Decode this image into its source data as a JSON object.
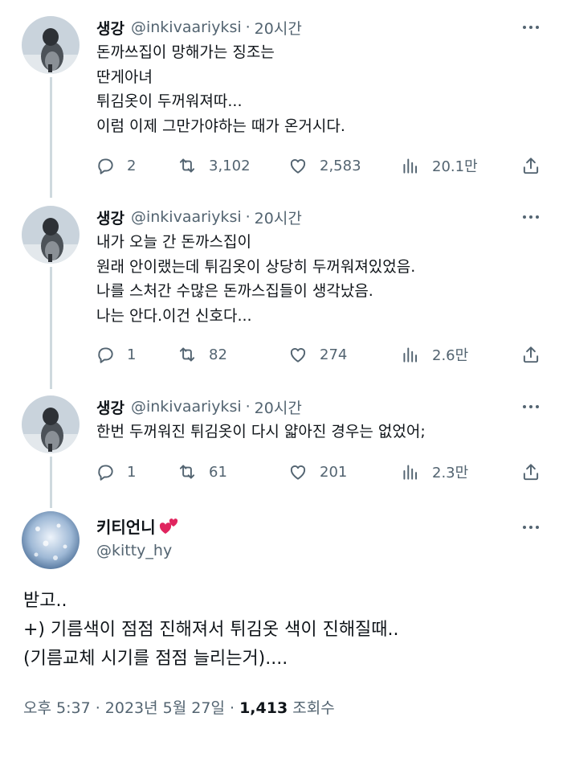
{
  "thread": [
    {
      "name": "생강",
      "handle": "@inkivaariyksi",
      "separator": "·",
      "time": "20시간",
      "lines": [
        "돈까쓰집이 망해가는 징조는",
        "딴게아녀",
        "튀김옷이 두꺼워져따...",
        "이럼 이제 그만가야하는 때가 온거시다."
      ],
      "replies": "2",
      "retweets": "3,102",
      "likes": "2,583",
      "views": "20.1만"
    },
    {
      "name": "생강",
      "handle": "@inkivaariyksi",
      "separator": "·",
      "time": "20시간",
      "lines": [
        "내가 오늘 간 돈까스집이",
        "원래 안이랬는데 튀김옷이 상당히 두꺼워져있었음.",
        "나를 스처간 수많은 돈까스집들이 생각났음.",
        "나는 안다.이건 신호다..."
      ],
      "replies": "1",
      "retweets": "82",
      "likes": "274",
      "views": "2.6만"
    },
    {
      "name": "생강",
      "handle": "@inkivaariyksi",
      "separator": "·",
      "time": "20시간",
      "lines": [
        "한번 두꺼워진 튀김옷이 다시 얇아진 경우는 없었어;"
      ],
      "replies": "1",
      "retweets": "61",
      "likes": "201",
      "views": "2.3만"
    }
  ],
  "main": {
    "name": "키티언니",
    "handle": "@kitty_hy",
    "lines": [
      "받고..",
      "+) 기름색이 점점 진해져서 튀김옷 색이 진해질때..",
      "(기름교체 시기를 점점 늘리는거)...."
    ],
    "time_label": "오후 5:37 · 2023년 5월 27일",
    "separator": "·",
    "views_count": "1,413",
    "views_label": "조회수"
  },
  "colors": {
    "text": "#0f1419",
    "secondary": "#536471",
    "thread_line": "#cfd9de",
    "heart": "#e0245e"
  },
  "icons": [
    "reply-icon",
    "retweet-icon",
    "like-icon",
    "views-icon",
    "share-icon",
    "more-icon",
    "heart-emoji-icon"
  ]
}
